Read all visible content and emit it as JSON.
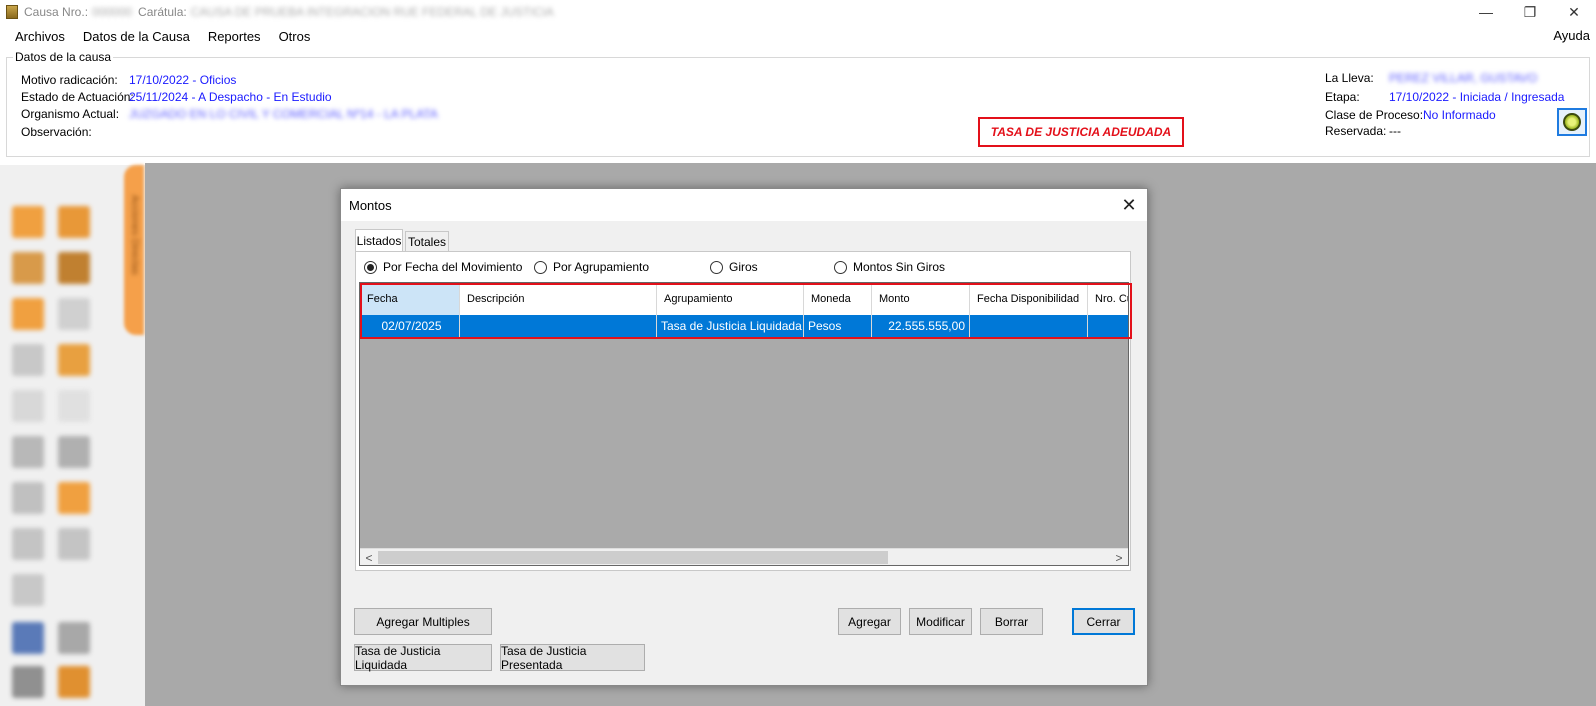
{
  "window": {
    "causa_label": "Causa Nro.:",
    "causa_value": "000000",
    "caratula_label": "Carátula:",
    "caratula_value": "CAUSA DE PRUEBA INTEGRACION RUE FEDERAL DE JUSTICIA",
    "minimize": "—",
    "restore": "❐",
    "close": "✕"
  },
  "menu": {
    "items": [
      "Archivos",
      "Datos de la Causa",
      "Reportes",
      "Otros"
    ],
    "help": "Ayuda"
  },
  "datos": {
    "legend": "Datos de la causa",
    "motivo_label": "Motivo radicación:",
    "motivo_value": "17/10/2022 - Oficios",
    "estado_label": "Estado de Actuación:",
    "estado_value": "25/11/2024 - A Despacho - En Estudio",
    "organismo_label": "Organismo Actual:",
    "organismo_value": "JUZGADO EN LO CIVIL Y COMERCIAL Nº14 - LA PLATA",
    "observacion_label": "Observación:",
    "lleva_label": "La Lleva:",
    "lleva_value": "PEREZ VILLAR, GUSTAVO",
    "etapa_label": "Etapa:",
    "etapa_value": "17/10/2022 - Iniciada / Ingresada",
    "clase_label": "Clase de Proceso:",
    "clase_value": "No Informado",
    "reservada_label": "Reservada:",
    "reservada_value": "---",
    "tasa_warning": "TASA DE JUSTICIA ADEUDADA"
  },
  "sidebar": {
    "tab_label": "Acciones Directas"
  },
  "dialog": {
    "title": "Montos",
    "close": "✕",
    "tabs": [
      "Listados",
      "Totales"
    ],
    "radios": [
      "Por Fecha del Movimiento",
      "Por Agrupamiento",
      "Giros",
      "Montos Sin Giros"
    ],
    "selected_radio": "Por Fecha del Movimiento",
    "columns": [
      "Fecha",
      "Descripción",
      "Agrupamiento",
      "Moneda",
      "Monto",
      "Fecha Disponibilidad",
      "Nro. Cu"
    ],
    "rows": [
      {
        "fecha": "02/07/2025",
        "descripcion": "",
        "agrupamiento": "Tasa de Justicia Liquidada",
        "moneda": "Pesos",
        "monto": "22.555.555,00",
        "fecha_disp": "",
        "nro": ""
      }
    ],
    "scroll_left": "<",
    "scroll_right": ">",
    "buttons": {
      "agregar_multiples": "Agregar Multiples",
      "agregar": "Agregar",
      "modificar": "Modificar",
      "borrar": "Borrar",
      "cerrar": "Cerrar",
      "tasa_liquidada": "Tasa de Justicia Liquidada",
      "tasa_presentada": "Tasa de Justicia Presentada"
    }
  },
  "colors": {
    "accent": "#0078d7",
    "warning": "#e3101a",
    "link": "#1a1aff",
    "icon_orange": "#f5a04a"
  }
}
